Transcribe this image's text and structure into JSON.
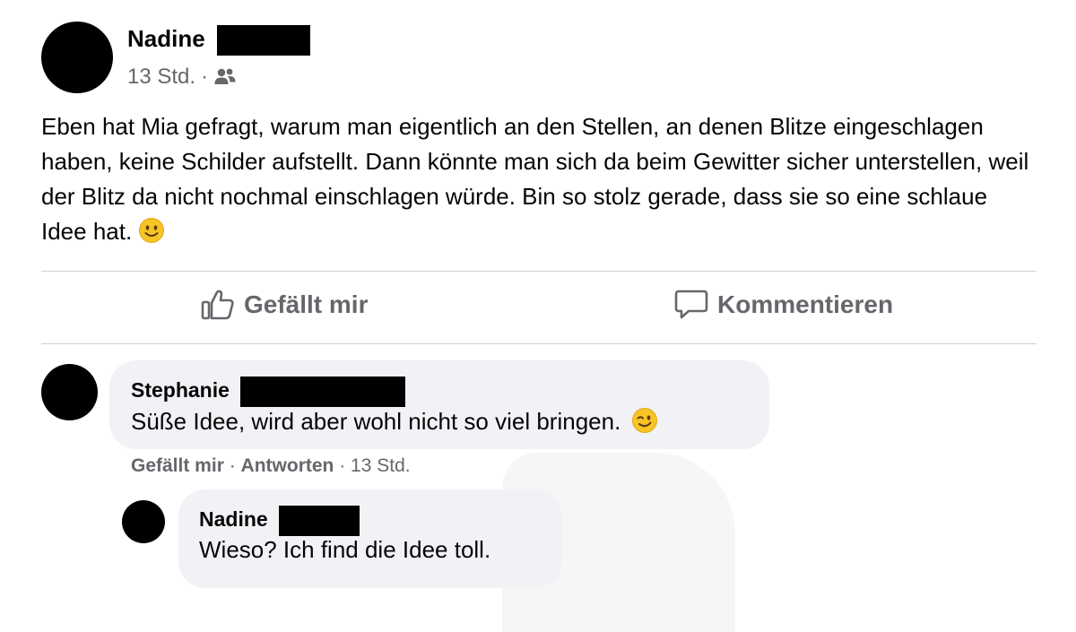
{
  "post": {
    "author": "Nadine",
    "time": "13 Std.",
    "separator": "·",
    "audience_icon": "friends-icon",
    "text": "Eben hat Mia gefragt, warum man eigentlich an den Stellen, an denen Blitze eingeschlagen haben, keine Schilder aufstellt. Dann könnte man sich da beim Gewitter sicher unterstellen, weil der Blitz da nicht nochmal einschlagen würde. Bin so stolz gerade, dass sie so eine schlaue Idee hat.",
    "emoji": "slightly-smiling-face"
  },
  "actions": {
    "like_label": "Gefällt mir",
    "comment_label": "Kommentieren"
  },
  "comments": [
    {
      "author": "Stephanie",
      "text": "Süße Idee, wird aber wohl nicht so viel bringen.",
      "emoji": "winking-face",
      "like_label": "Gefällt mir",
      "reply_label": "Antworten",
      "time": "13 Std."
    },
    {
      "author": "Nadine",
      "text": "Wieso? Ich find die Idee toll."
    }
  ],
  "colors": {
    "secondary_text": "#65676b",
    "bubble": "#f0f2f5",
    "divider": "#ced0d4"
  }
}
